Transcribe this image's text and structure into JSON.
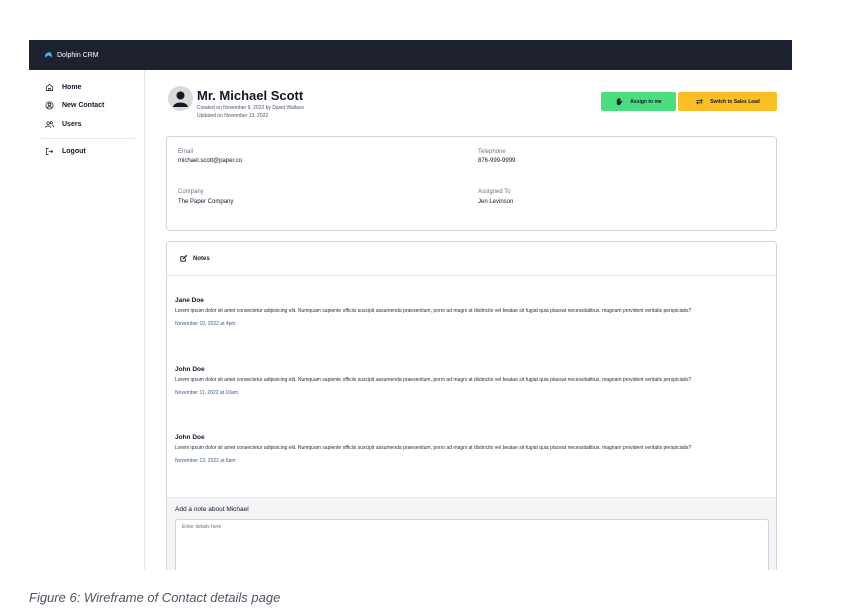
{
  "app": {
    "name": "Dolphin CRM",
    "logo_icon": "dolphin-icon",
    "colors": {
      "topbar": "#1e2230",
      "assign": "#4ade80",
      "switch": "#fbbf24",
      "timestamp": "#3b5b8f"
    }
  },
  "sidebar": {
    "items": [
      {
        "label": "Home",
        "icon": "home-icon"
      },
      {
        "label": "New Contact",
        "icon": "add-contact-icon"
      },
      {
        "label": "Users",
        "icon": "users-icon"
      }
    ],
    "logout": {
      "label": "Logout",
      "icon": "logout-icon"
    }
  },
  "contact": {
    "name": "Mr. Michael Scott",
    "created": "Created on November 9, 2022 by David Wallace",
    "updated": "Updated on November 13, 2022",
    "avatar_icon": "user-avatar-icon"
  },
  "actions": {
    "assign_label": "Assign to me",
    "assign_icon": "hand-icon",
    "switch_label": "Switch to Sales Lead",
    "switch_icon": "switch-arrows-icon"
  },
  "details": {
    "email_label": "Email",
    "email": "michael.scott@paper.co",
    "telephone_label": "Telephone",
    "telephone": "876-999-9999",
    "company_label": "Company",
    "company": "The Paper Company",
    "assigned_label": "Assigned To",
    "assigned": "Jen Levinson"
  },
  "notes": {
    "title": "Notes",
    "icon": "edit-icon",
    "items": [
      {
        "author": "Jane Doe",
        "body": "Lorem ipsum dolor sit amet consectetur adipisicing elit. Numquam sapiente officiis suscipit assumenda praesentium, porro ad magni at distinctio vel beatae sit fugiat quia placeat necessitatibus, magnam provident veritatis perspiciatis?",
        "time": "November 10, 2022 at 4pm"
      },
      {
        "author": "John Doe",
        "body": "Lorem ipsum dolor sit amet consectetur adipisicing elit. Numquam sapiente officiis suscipit assumenda praesentium, porro ad magni at distinctio vel beatae sit fugiat quia placeat necessitatibus, magnam provident veritatis perspiciatis?",
        "time": "November 11, 2022 at 10am"
      },
      {
        "author": "John Doe",
        "body": "Lorem ipsum dolor sit amet consectetur adipisicing elit. Numquam sapiente officiis suscipit assumenda praesentium, porro ad magni at distinctio vel beatae sit fugiat quia placeat necessitatibus, magnam provident veritatis perspiciatis?",
        "time": "November 13, 2022 at 6pm"
      }
    ],
    "add_label": "Add a note about Michael",
    "add_placeholder": "Enter details here"
  },
  "caption": "Figure 6: Wireframe of Contact details page"
}
